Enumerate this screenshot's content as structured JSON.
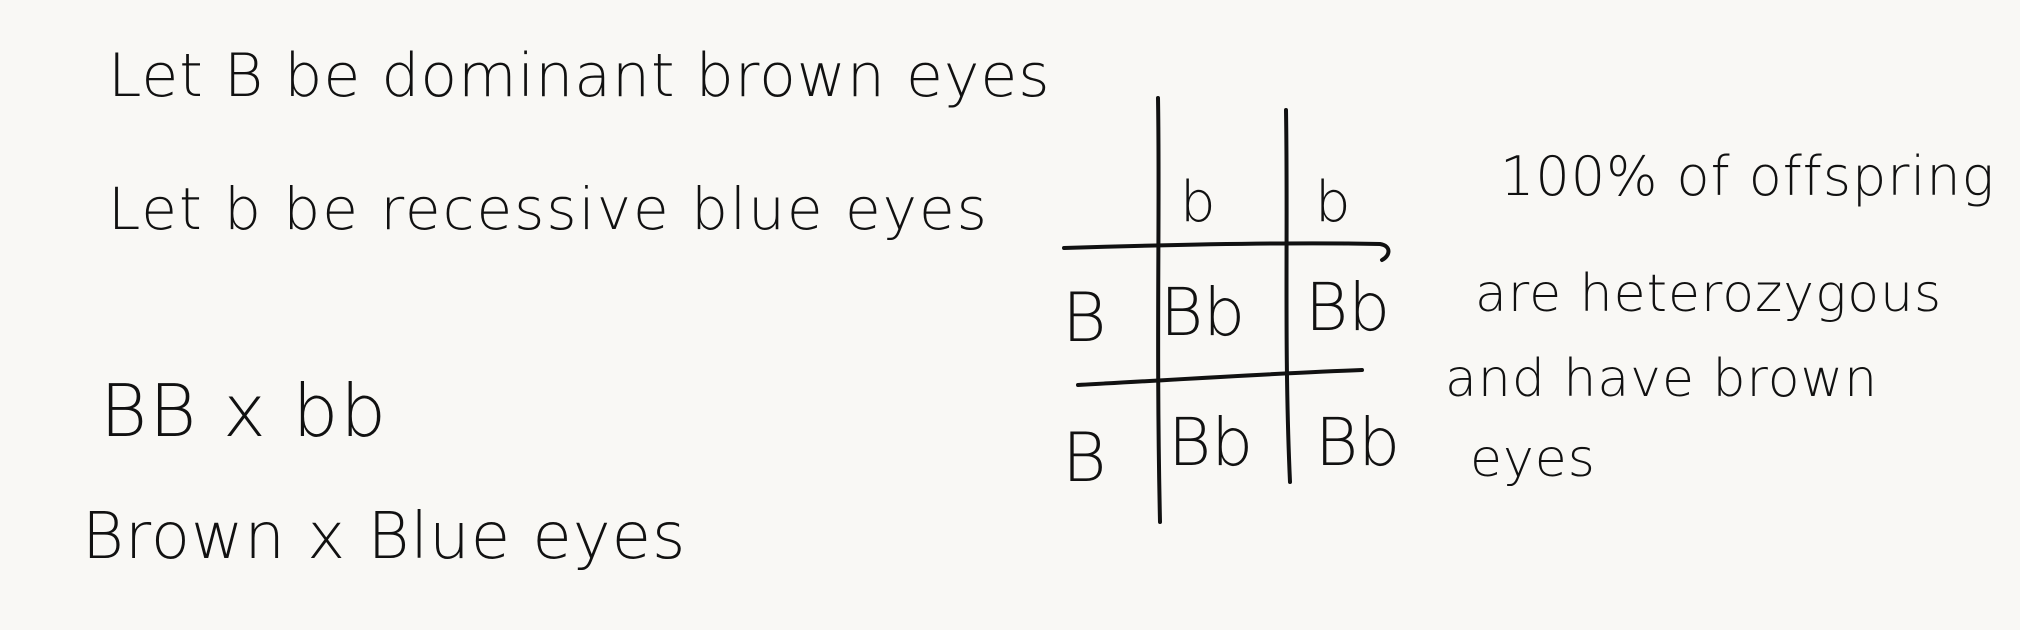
{
  "definitions": {
    "dominant": "Let B be dominant brown eyes",
    "recessive": "Let b be recessive blue eyes"
  },
  "cross": {
    "genotype": "BB x bb",
    "phenotype": "Brown x Blue eyes"
  },
  "punnett": {
    "column_alleles": [
      "b",
      "b"
    ],
    "row_alleles": [
      "B",
      "B"
    ],
    "cells": [
      [
        "Bb",
        "Bb"
      ],
      [
        "Bb",
        "Bb"
      ]
    ]
  },
  "conclusion": {
    "line_1": "100% of offspring",
    "line_2": "are heterozygous",
    "line_3": "and have brown",
    "line_4": "eyes"
  }
}
